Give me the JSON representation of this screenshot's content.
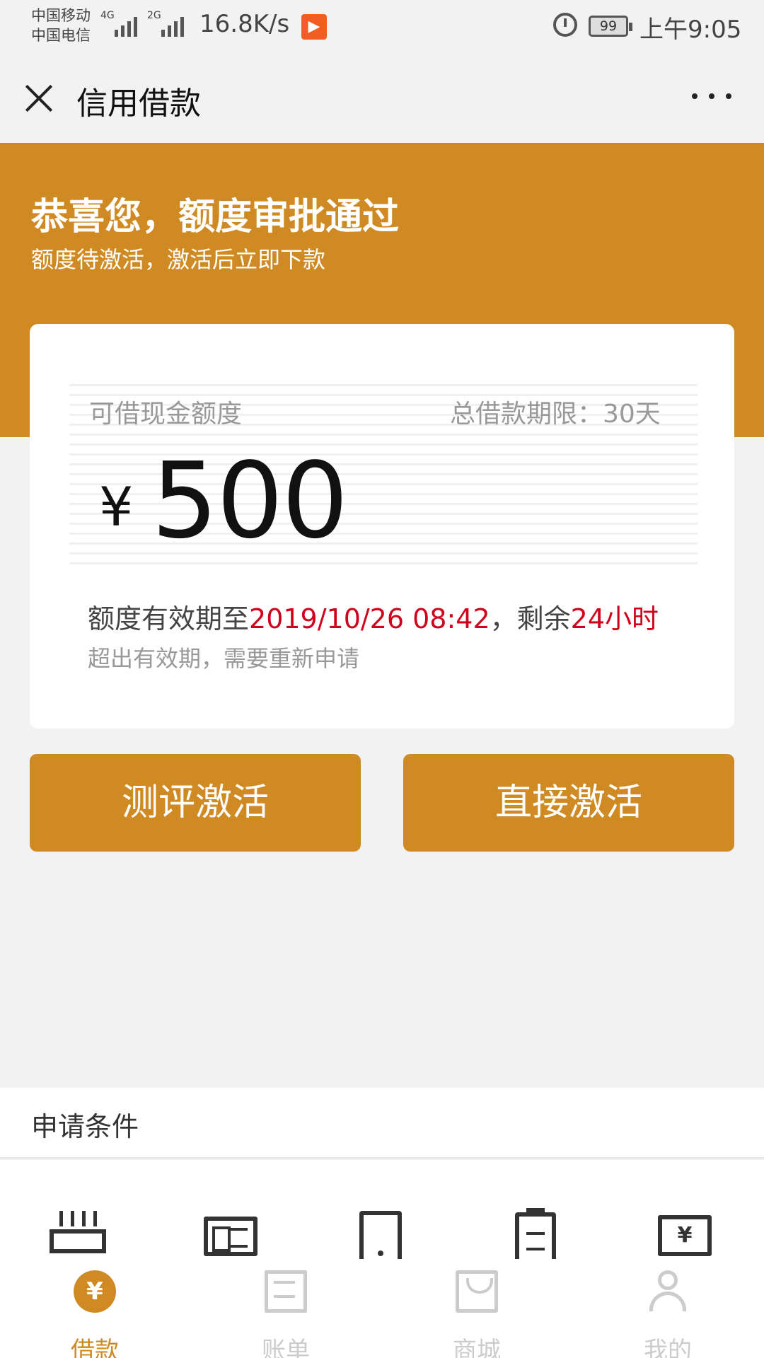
{
  "status_bar": {
    "carrier_1": "中国移动",
    "carrier_2": "中国电信",
    "signal_1": "4G",
    "signal_2": "2G",
    "net_speed": "16.8K/s",
    "app_icon": "video-app-icon",
    "battery": "99",
    "time": "上午9:05"
  },
  "header": {
    "title": "信用借款"
  },
  "banner": {
    "title": "恭喜您，额度审批通过",
    "subtitle": "额度待激活，激活后立即下款",
    "color": "#d08a23"
  },
  "credit_card": {
    "label": "可借现金额度",
    "term_label": "总借款期限：30天",
    "currency": "¥",
    "amount": "500",
    "validity_prefix": "额度有效期至",
    "validity_date": "2019/10/26 08:42",
    "validity_mid": "，剩余",
    "validity_remaining": "24小时",
    "hint": "超出有效期，需要重新申请"
  },
  "actions": {
    "evaluate_label": "测评激活",
    "direct_label": "直接激活"
  },
  "conditions": {
    "label": "申请条件",
    "icons": [
      "router-icon",
      "id-card-icon",
      "phone-icon",
      "clipboard-icon",
      "cash-icon"
    ]
  },
  "tabbar": {
    "tabs": [
      {
        "label": "借款",
        "icon": "loan-yen-icon",
        "active": true
      },
      {
        "label": "账单",
        "icon": "bill-icon",
        "active": false
      },
      {
        "label": "商城",
        "icon": "mall-bag-icon",
        "active": false
      },
      {
        "label": "我的",
        "icon": "user-icon",
        "active": false
      }
    ],
    "active_color": "#d08a23",
    "inactive_color": "#cccccc"
  },
  "colors": {
    "accent": "#d08a23",
    "highlight_red": "#d0021b"
  }
}
